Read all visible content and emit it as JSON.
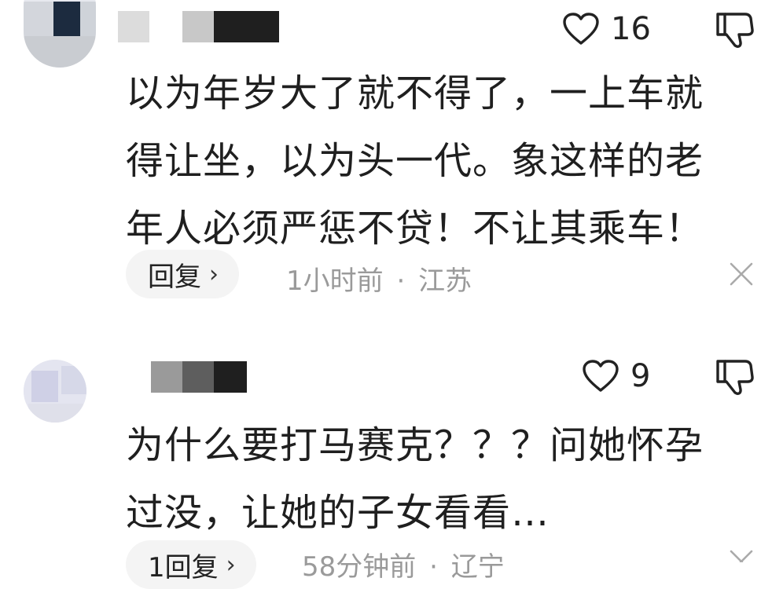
{
  "comments": [
    {
      "likes": "16",
      "text_lines": [
        "以为年岁大了就不得了，一上车就",
        "得让坐，以为头一代。象这样的老",
        "年人必须严惩不贷！不让其乘车！"
      ],
      "reply_label": "回复",
      "reply_chevron": "›",
      "time": "1小时前",
      "separator": "·",
      "location": "江苏"
    },
    {
      "likes": "9",
      "text_lines": [
        "为什么要打马赛克？？？问她怀孕",
        "过没，让她的子女看看…"
      ],
      "reply_label": "1回复",
      "reply_chevron": "›",
      "time": "58分钟前",
      "separator": "·",
      "location": "辽宁"
    }
  ],
  "icons": {
    "like": "heart-outline-icon",
    "dislike": "thumbs-down-outline-icon",
    "close": "close-icon"
  }
}
